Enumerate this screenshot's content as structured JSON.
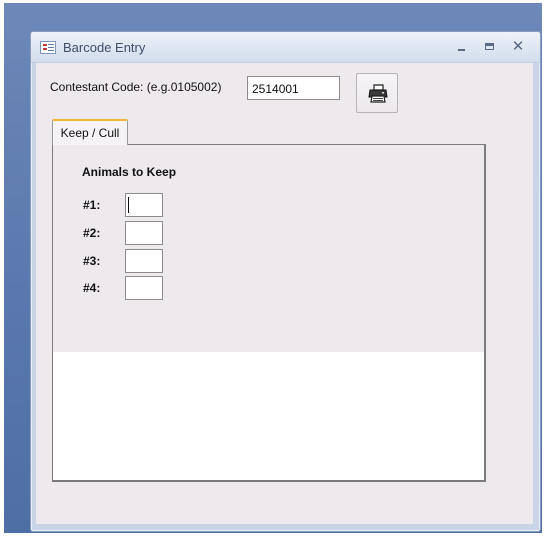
{
  "window": {
    "title": "Barcode Entry",
    "controls": {
      "minimize_icon": "minimize-icon",
      "maximize_icon": "maximize-icon",
      "close_icon": "close-icon",
      "close_glyph": "✕"
    }
  },
  "header": {
    "code_label": "Contestant Code: (e.g.0105002)",
    "code_value": "2514001",
    "print_button_icon": "printer-icon"
  },
  "tabs": [
    {
      "label": "Keep / Cull",
      "active": true
    }
  ],
  "keep_section": {
    "title": "Animals to Keep",
    "rows": [
      {
        "label": "#1:",
        "value": ""
      },
      {
        "label": "#2:",
        "value": ""
      },
      {
        "label": "#3:",
        "value": ""
      },
      {
        "label": "#4:",
        "value": ""
      }
    ]
  },
  "colors": {
    "active_tab_accent": "#f2b637",
    "form_background": "#ede9ed",
    "desktop_background": "#5a78ad"
  }
}
